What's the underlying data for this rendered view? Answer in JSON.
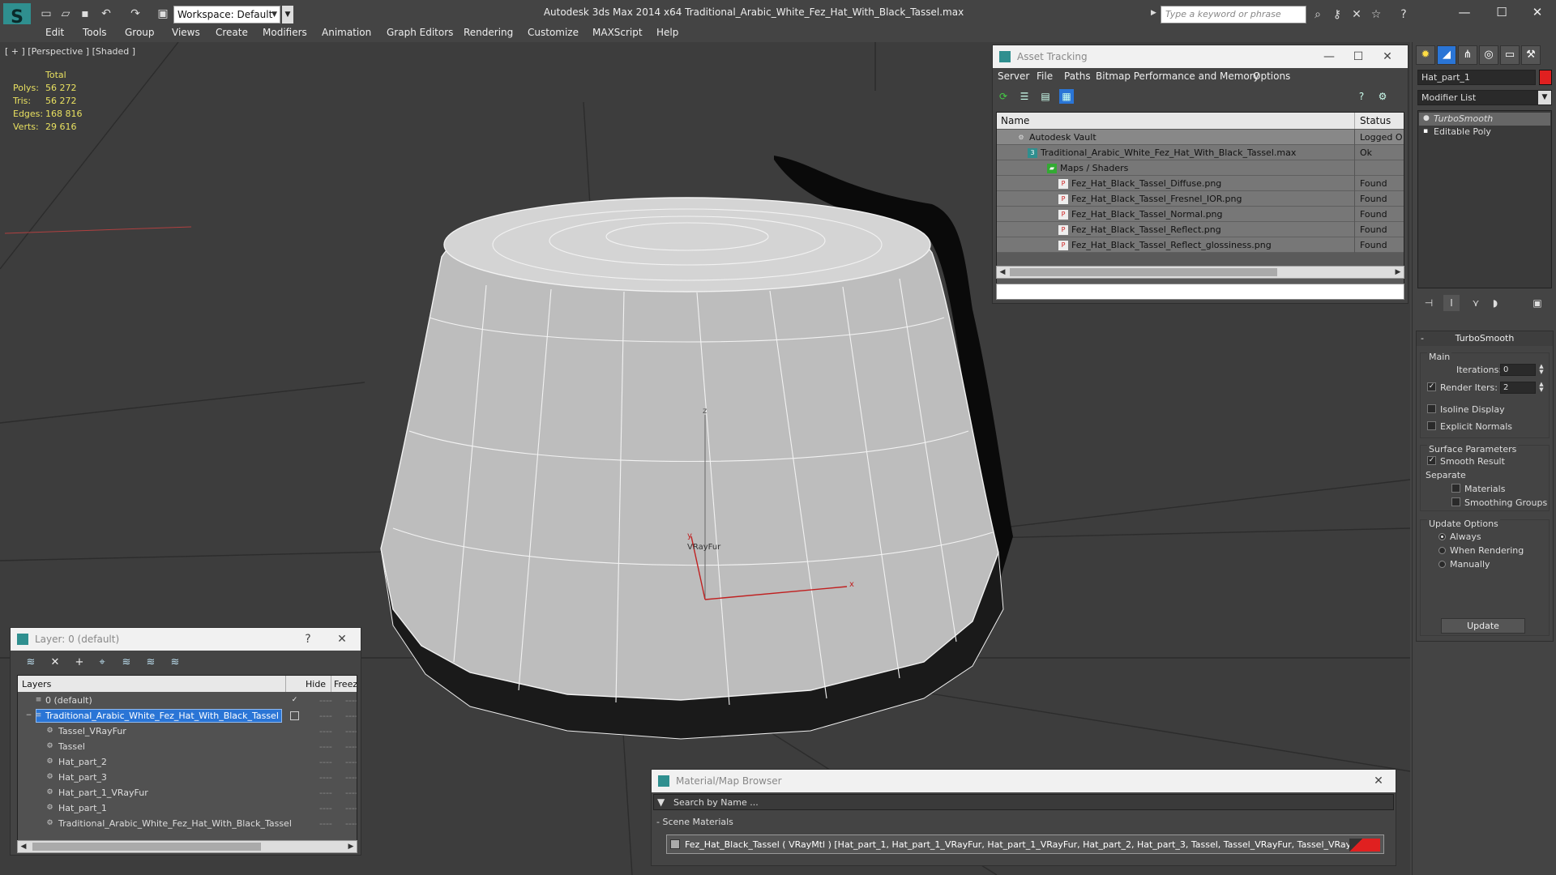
{
  "titlebar": {
    "workspace": "Workspace: Default",
    "window_title": "Autodesk 3ds Max  2014 x64      Traditional_Arabic_White_Fez_Hat_With_Black_Tassel.max",
    "search_placeholder": "Type a keyword or phrase"
  },
  "menu": [
    "Edit",
    "Tools",
    "Group",
    "Views",
    "Create",
    "Modifiers",
    "Animation",
    "Graph Editors",
    "Rendering",
    "Customize",
    "MAXScript",
    "Help"
  ],
  "viewport": {
    "label": "[ + ] [Perspective ] [Shaded ]",
    "stats_header": "Total",
    "stats": [
      {
        "label": "Polys:",
        "value": "56 272"
      },
      {
        "label": "Tris:",
        "value": "56 272"
      },
      {
        "label": "Edges:",
        "value": "168 816"
      },
      {
        "label": "Verts:",
        "value": "29 616"
      }
    ],
    "gizmo": {
      "x": "x",
      "y": "y",
      "z": "z",
      "name": "VRayFur"
    }
  },
  "asset_tracking": {
    "title": "Asset Tracking",
    "menu": [
      "Server",
      "File",
      "Paths",
      "Bitmap Performance and Memory",
      "Options"
    ],
    "columns": {
      "name": "Name",
      "status": "Status"
    },
    "rows": [
      {
        "name": "Autodesk Vault",
        "status": "Logged O",
        "indent": 1
      },
      {
        "name": "Traditional_Arabic_White_Fez_Hat_With_Black_Tassel.max",
        "status": "Ok",
        "indent": 2
      },
      {
        "name": "Maps / Shaders",
        "status": "",
        "indent": 3
      },
      {
        "name": "Fez_Hat_Black_Tassel_Diffuse.png",
        "status": "Found",
        "indent": 4
      },
      {
        "name": "Fez_Hat_Black_Tassel_Fresnel_IOR.png",
        "status": "Found",
        "indent": 4
      },
      {
        "name": "Fez_Hat_Black_Tassel_Normal.png",
        "status": "Found",
        "indent": 4
      },
      {
        "name": "Fez_Hat_Black_Tassel_Reflect.png",
        "status": "Found",
        "indent": 4
      },
      {
        "name": "Fez_Hat_Black_Tassel_Reflect_glossiness.png",
        "status": "Found",
        "indent": 4
      }
    ]
  },
  "command_panel": {
    "object_name": "Hat_part_1",
    "modifier_list": "Modifier List",
    "stack": [
      "TurboSmooth",
      "Editable Poly"
    ],
    "turbosmooth": {
      "title": "TurboSmooth",
      "main": "Main",
      "iterations_label": "Iterations:",
      "iterations": "0",
      "render_iters_label": "Render Iters:",
      "render_iters": "2",
      "isoline": "Isoline Display",
      "explicit_normals": "Explicit Normals",
      "surface_params": "Surface Parameters",
      "smooth_result": "Smooth Result",
      "separate": "Separate",
      "materials": "Materials",
      "smoothing_groups": "Smoothing Groups",
      "update_options": "Update Options",
      "always": "Always",
      "when_rendering": "When Rendering",
      "manually": "Manually",
      "update": "Update"
    }
  },
  "layer_panel": {
    "title": "Layer: 0 (default)",
    "columns": {
      "layers": "Layers",
      "hide": "Hide",
      "freeze": "Freeze"
    },
    "rows": [
      {
        "name": "0 (default)",
        "indent": 0,
        "selected": false
      },
      {
        "name": "Traditional_Arabic_White_Fez_Hat_With_Black_Tassel",
        "indent": 0,
        "selected": true
      },
      {
        "name": "Tassel_VRayFur",
        "indent": 1,
        "selected": false
      },
      {
        "name": "Tassel",
        "indent": 1,
        "selected": false
      },
      {
        "name": "Hat_part_2",
        "indent": 1,
        "selected": false
      },
      {
        "name": "Hat_part_3",
        "indent": 1,
        "selected": false
      },
      {
        "name": "Hat_part_1_VRayFur",
        "indent": 1,
        "selected": false
      },
      {
        "name": "Hat_part_1",
        "indent": 1,
        "selected": false
      },
      {
        "name": "Traditional_Arabic_White_Fez_Hat_With_Black_Tassel",
        "indent": 1,
        "selected": false
      }
    ],
    "dash": "----"
  },
  "material_browser": {
    "title": "Material/Map Browser",
    "search_placeholder": "Search by Name ...",
    "section": "- Scene Materials",
    "material": "Fez_Hat_Black_Tassel  ( VRayMtl )  [Hat_part_1, Hat_part_1_VRayFur, Hat_part_1_VRayFur, Hat_part_2, Hat_part_3, Tassel, Tassel_VRayFur, Tassel_VRayFur]"
  },
  "colors": {
    "accent": "#2a75d6",
    "object_color": "#e02020",
    "stats_text": "#e8e060"
  }
}
